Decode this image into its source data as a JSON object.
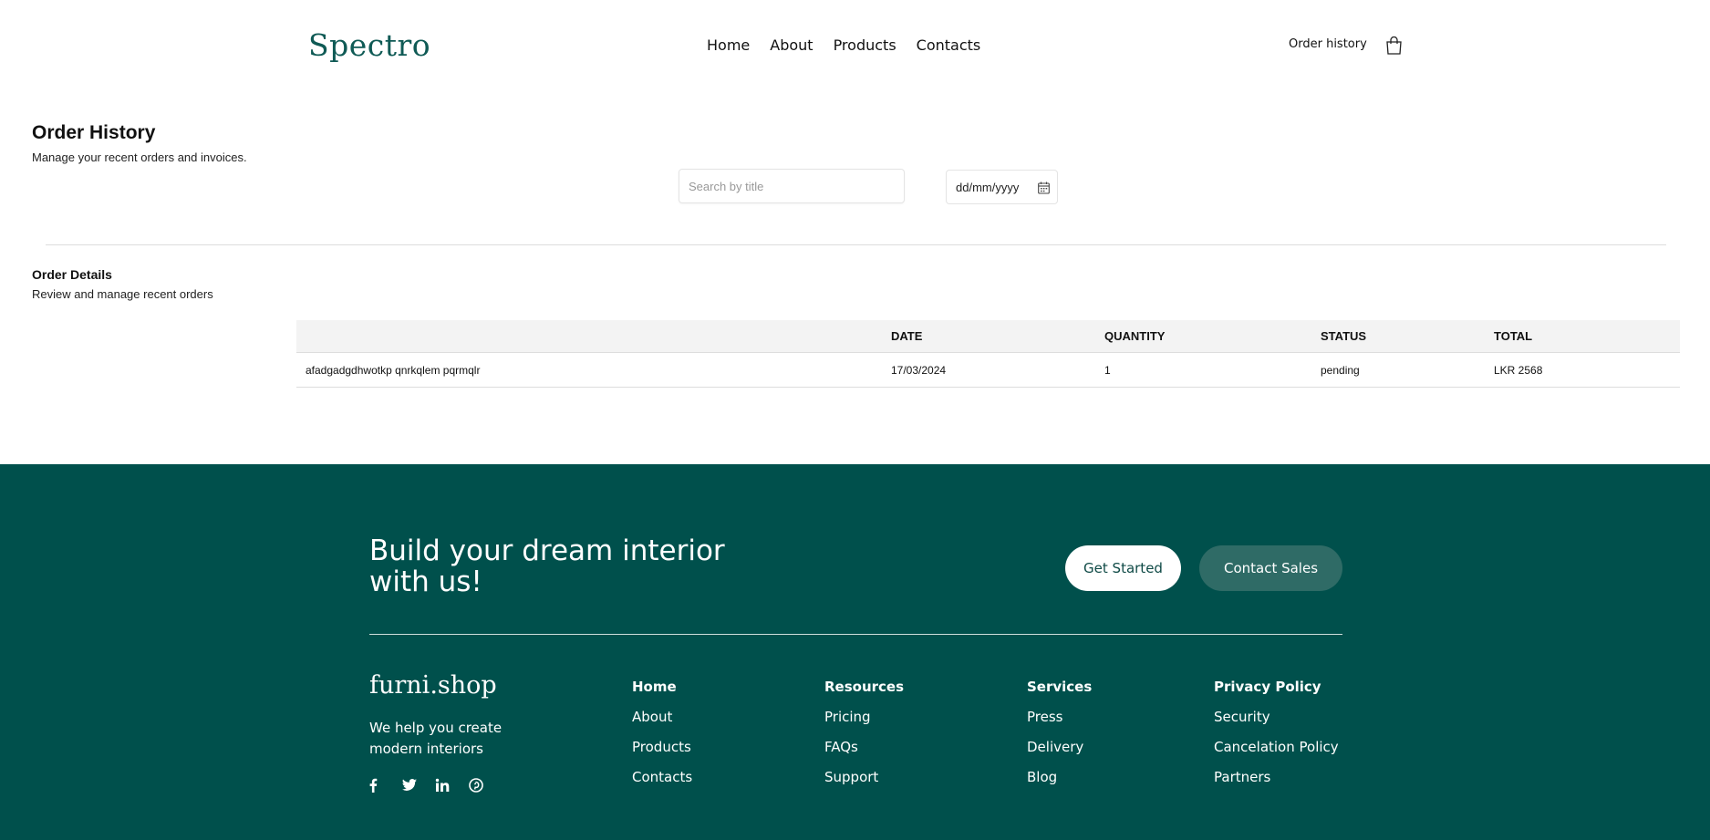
{
  "header": {
    "logo": "Spectro",
    "nav": [
      "Home",
      "About",
      "Products",
      "Contacts"
    ],
    "order_history_link": "Order history",
    "cart_icon": "shopping-bag-icon"
  },
  "order_history": {
    "title": "Order History",
    "subtitle": "Manage your recent orders and invoices.",
    "search_placeholder": "Search by title",
    "date_placeholder": "dd/mm/yyyy",
    "calendar_icon": "calendar-icon"
  },
  "order_details": {
    "title": "Order Details",
    "subtitle": "Review and manage recent orders",
    "columns": [
      "",
      "DATE",
      "QUANTITY",
      "STATUS",
      "TOTAL"
    ],
    "rows": [
      [
        "afadgadgdhwotkp qnrkqlem pqrmqlr",
        "17/03/2024",
        "1",
        "pending",
        "LKR 2568"
      ]
    ]
  },
  "footer": {
    "cta_title": "Build your dream interior with us!",
    "get_started": "Get Started",
    "contact_sales": "Contact Sales",
    "brand": "furni.shop",
    "tagline": "We help you create modern interiors",
    "socials": [
      "facebook-icon",
      "twitter-icon",
      "linkedin-icon",
      "pinterest-icon"
    ],
    "columns": [
      [
        "Home",
        "About",
        "Products",
        "Contacts"
      ],
      [
        "Resources",
        "Pricing",
        "FAQs",
        "Support"
      ],
      [
        "Services",
        "Press",
        "Delivery",
        "Blog"
      ],
      [
        "Privacy Policy",
        "Security",
        "Cancelation Policy",
        "Partners"
      ]
    ]
  },
  "colors": {
    "brand": "#0f5a55",
    "footer_bg": "#00504c",
    "secondary_button": "#2f6b66"
  }
}
